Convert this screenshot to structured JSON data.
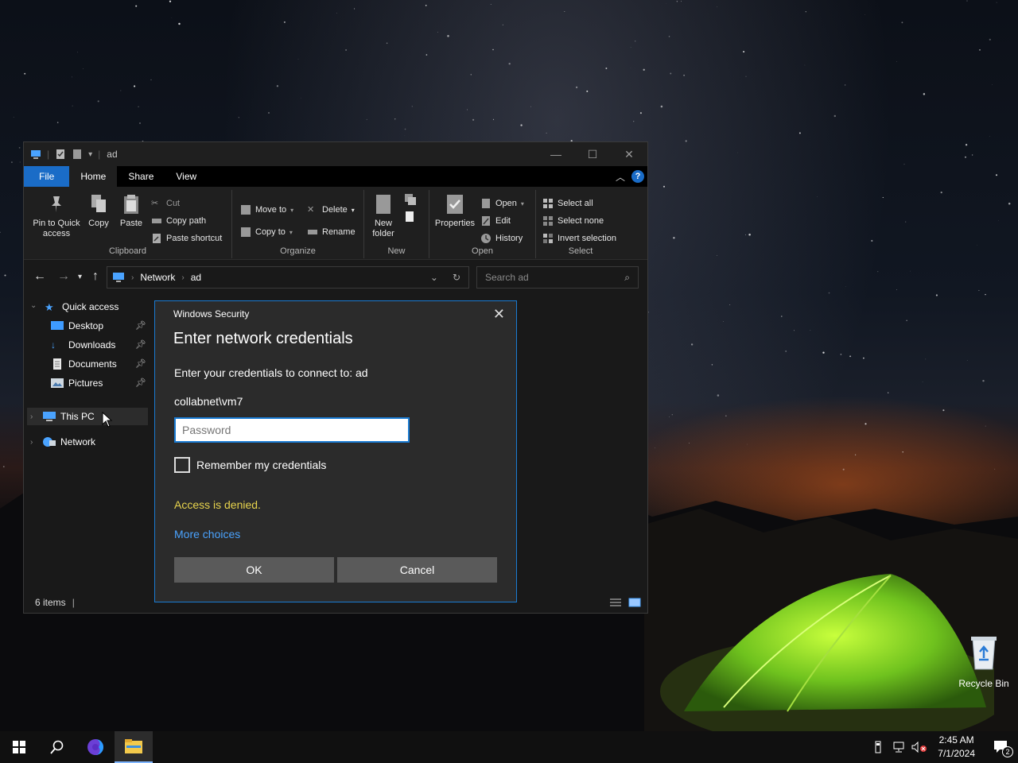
{
  "explorer": {
    "title": "ad",
    "tabs": [
      "File",
      "Home",
      "Share",
      "View"
    ],
    "ribbon": {
      "clipboard": {
        "label": "Clipboard",
        "pin_label_1": "Pin to Quick",
        "pin_label_2": "access",
        "copy": "Copy",
        "paste": "Paste",
        "cut": "Cut",
        "copy_path": "Copy path",
        "paste_shortcut": "Paste shortcut"
      },
      "organize": {
        "label": "Organize",
        "move_to": "Move to",
        "copy_to": "Copy to",
        "delete": "Delete",
        "rename": "Rename"
      },
      "new": {
        "label": "New",
        "new_folder_1": "New",
        "new_folder_2": "folder"
      },
      "open": {
        "label": "Open",
        "properties": "Properties",
        "open": "Open",
        "edit": "Edit",
        "history": "History"
      },
      "select": {
        "label": "Select",
        "select_all": "Select all",
        "select_none": "Select none",
        "invert": "Invert selection"
      }
    },
    "address": {
      "root": "Network",
      "current": "ad"
    },
    "search": {
      "placeholder": "Search ad"
    },
    "nav": {
      "quick_access": "Quick access",
      "desktop": "Desktop",
      "downloads": "Downloads",
      "documents": "Documents",
      "pictures": "Pictures",
      "this_pc": "This PC",
      "network": "Network"
    },
    "status": "6 items"
  },
  "dialog": {
    "title": "Windows Security",
    "heading": "Enter network credentials",
    "prompt": "Enter your credentials to connect to: ad",
    "username": "collabnet\\vm7",
    "password_placeholder": "Password",
    "remember": "Remember my credentials",
    "error": "Access is denied.",
    "more_choices": "More choices",
    "ok": "OK",
    "cancel": "Cancel"
  },
  "desktop": {
    "recycle_bin": "Recycle Bin"
  },
  "taskbar": {
    "time": "2:45 AM",
    "date": "7/1/2024",
    "notification_count": "2"
  },
  "colors": {
    "accent": "#1a7bd2",
    "file_tab": "#1a6cc7",
    "error_text": "#e8d44d",
    "link": "#4aa3ff"
  }
}
